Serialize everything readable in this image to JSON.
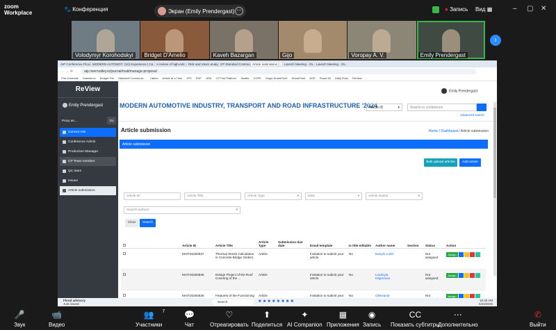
{
  "zoom": {
    "logo_line1": "zoom",
    "logo_line2": "Workplace",
    "conference_label": "Конференция",
    "screen_label": "Экран (Emily Prendergast)",
    "recording_label": "Запись",
    "view_label": "Вид",
    "participants": [
      {
        "name": "Volodymyr Korohodskyi",
        "bg": "#6f7c83"
      },
      {
        "name": "Bridget D'Amelio",
        "bg": "#8a5a3d"
      },
      {
        "name": "Kaveh Bazargan",
        "bg": "#7b7267"
      },
      {
        "name": "Gijo",
        "bg": "#a38a6c"
      },
      {
        "name": "Voropay A. V.",
        "bg": "#8c8677"
      },
      {
        "name": "Emily Prendergast",
        "bg": "#3f4a43"
      }
    ],
    "toolbar": [
      {
        "label": "Звук",
        "icon": "mic-muted-icon",
        "glyph": "🎤"
      },
      {
        "label": "Видео",
        "icon": "video-icon",
        "glyph": "📹"
      },
      {
        "label": "Участники",
        "icon": "participants-icon",
        "glyph": "👥",
        "count": "7"
      },
      {
        "label": "Чат",
        "icon": "chat-icon",
        "glyph": "💬"
      },
      {
        "label": "Отреагировать",
        "icon": "react-icon",
        "glyph": "♡"
      },
      {
        "label": "Поделиться",
        "icon": "share-icon",
        "glyph": "⬆"
      },
      {
        "label": "AI Companion",
        "icon": "ai-companion-icon",
        "glyph": "✦"
      },
      {
        "label": "Приложения",
        "icon": "apps-icon",
        "glyph": "▦"
      },
      {
        "label": "Запись",
        "icon": "record-icon",
        "glyph": "◉"
      },
      {
        "label": "Показать субтитры",
        "icon": "captions-icon",
        "glyph": "CC"
      },
      {
        "label": "Дополнительно",
        "icon": "more-icon",
        "glyph": "⋯"
      },
      {
        "label": "Выйти",
        "icon": "leave-icon",
        "glyph": "✆"
      }
    ]
  },
  "browser": {
    "tabs": [
      "AIP Conference Proce...",
      "MODERN AUTOMOTIV...",
      "(10) Experience | Ca...",
      "A review of high-enti...",
      "Risk and return analy...",
      "CP Standard Commun...",
      "Article submission | ...",
      "Launch Meeting - Zo...",
      "Launch Meeting - Zo..."
    ],
    "url": "aip.riverrvalley.io/journal/mait/manage-proposal",
    "bookmarks": [
      "Pub Schedule",
      "Salesforce",
      "Budget File",
      "Standard Communic...",
      "Lattice",
      "Article at a Time",
      "JPS",
      "RXP",
      "JIRA",
      "CP Pub Platform",
      "Seafile",
      "COPE",
      "Origin SharePoint",
      "SharePoint",
      "AOP",
      "Power BI",
      "Daily Pubs",
      "ReView"
    ]
  },
  "sidebar": {
    "brand": "ReView",
    "user": "Emily Prendergast",
    "proxy_label": "Proxy as...",
    "go_label": "Go",
    "items": [
      {
        "label": "Current role"
      },
      {
        "label": "Conference Admin"
      },
      {
        "label": "Production Manager"
      },
      {
        "label": "CP Team member"
      },
      {
        "label": "QC team"
      },
      {
        "label": "Issues"
      },
      {
        "label": "Article submission"
      }
    ]
  },
  "header": {
    "user": "Emily Prendergast",
    "conference_title": "MODERN AUTOMOTIVE INDUSTRY, TRANSPORT AND ROAD INFRASTRUCTURE '2024",
    "search_select": "Article ID",
    "search_placeholder": "Search in conference",
    "advanced_search": "Advanced search"
  },
  "page": {
    "title": "Article submission",
    "breadcrumb": [
      "Home",
      "Dashboard",
      "Article submission"
    ],
    "section_bar": "Article submission",
    "bulk_upload": "Bulk upload articles",
    "add_article": "Add article",
    "filters": {
      "article_id": "Article ID",
      "article_title": "Article Title",
      "article_type": "Article Type",
      "date": "Date",
      "article_status": "Article Status",
      "search_authors": "Search authors"
    },
    "clear": "Clear",
    "search": "Search"
  },
  "table": {
    "headers": [
      "Article ID",
      "Article Title",
      "Article Type",
      "Submission due date",
      "Email template",
      "Is title editable",
      "Author name",
      "Section",
      "Status",
      "Action"
    ],
    "rows": [
      {
        "id": "MAIT20250537",
        "title": "Thermal Stress Calculation in Concrete Bridge Girders",
        "type": "Article",
        "due": "",
        "email": "Invitation to submit your article",
        "editable": "No",
        "author": "Danylo Lukin",
        "section": "",
        "status": "Not assigned",
        "assign": "Assign"
      },
      {
        "id": "MAIT20250536",
        "title": "Design Project of the Roof Covering of the ...",
        "type": "Article",
        "due": "",
        "email": "Invitation to submit your article",
        "editable": "No",
        "author": "Liudmyla Haponova",
        "section": "",
        "status": "Not assigned",
        "assign": "Assign"
      },
      {
        "id": "MAIT20250535",
        "title": "Features of the Functioning and Energy-Saving Management of ...",
        "type": "Article",
        "due": "",
        "email": "Invitation to submit your article",
        "editable": "No",
        "author": "Oleksandr Shamych",
        "section": "",
        "status": "Not assigned",
        "assign": "Assign"
      }
    ]
  },
  "taskbar": {
    "weather_title": "Flood advisory",
    "weather_sub": "Just issued",
    "search": "Search",
    "time": "10:40 AM",
    "date": "5/22/2025"
  }
}
